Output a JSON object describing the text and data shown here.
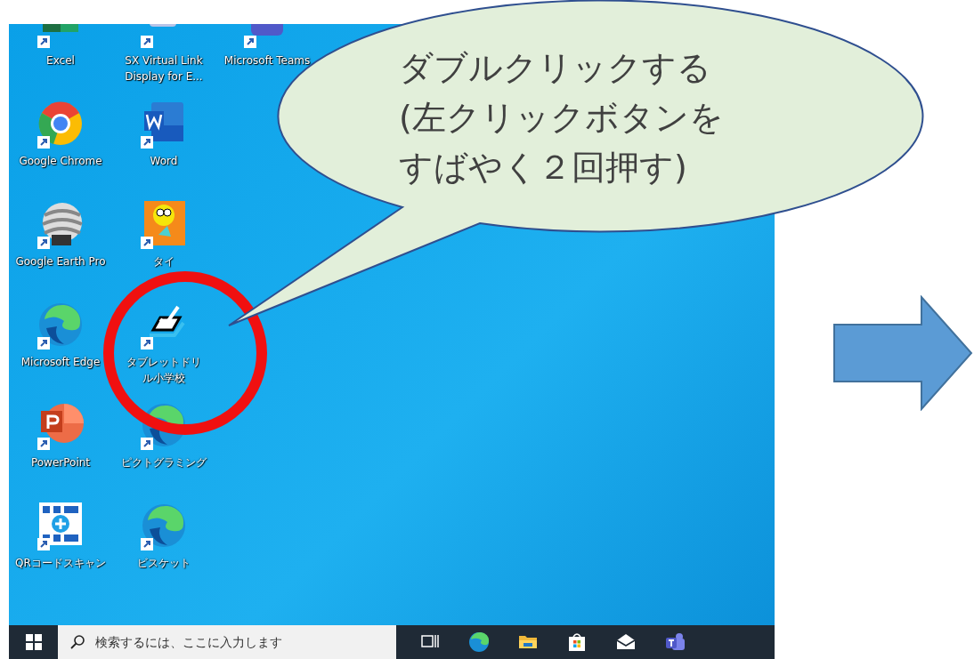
{
  "desktop": {
    "columns": [
      [
        {
          "label": "Excel",
          "kind": "excel"
        },
        {
          "label": "Google Chrome",
          "kind": "chrome"
        },
        {
          "label": "Google Earth Pro",
          "kind": "earth"
        },
        {
          "label": "Microsoft Edge",
          "kind": "edge"
        },
        {
          "label": "PowerPoint",
          "kind": "powerpoint"
        },
        {
          "label": "QRコードスキャン",
          "kind": "qr"
        }
      ],
      [
        {
          "label": "SX Virtual Link Display for E...",
          "kind": "sx"
        },
        {
          "label": "Word",
          "kind": "word"
        },
        {
          "label": "タイ",
          "kind": "cartoon"
        },
        {
          "label": "タブレットドリル小学校",
          "kind": "drill"
        },
        {
          "label": "ピクトグラミング",
          "kind": "edge"
        },
        {
          "label": "ビスケット",
          "kind": "edge"
        }
      ],
      [
        {
          "label": "Microsoft Teams",
          "kind": "teams"
        }
      ]
    ]
  },
  "callout": {
    "lines": [
      "ダブルクリックする",
      "(左クリックボタンを",
      "すばやく２回押す)"
    ]
  },
  "taskbar": {
    "search": {
      "placeholder": "検索するには、ここに入力します"
    },
    "apps": [
      {
        "kind": "taskview"
      },
      {
        "kind": "edge"
      },
      {
        "kind": "folder"
      },
      {
        "kind": "store"
      },
      {
        "kind": "mail"
      },
      {
        "kind": "teams"
      }
    ]
  }
}
